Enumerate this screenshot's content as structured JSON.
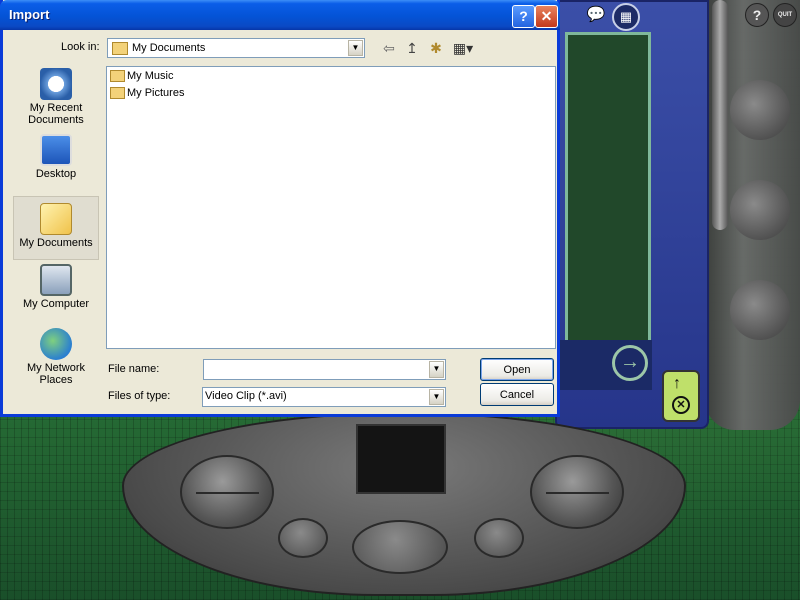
{
  "dialog": {
    "title": "Import",
    "help_btn": "?",
    "close_btn": "✕",
    "lookin_label": "Look in:",
    "lookin_value": "My Documents",
    "toolbar": {
      "back": "⇦",
      "up": "↥",
      "new_folder": "✱",
      "view": "▦▾"
    },
    "places": [
      {
        "label": "My Recent Documents",
        "icon": "recent-documents-icon"
      },
      {
        "label": "Desktop",
        "icon": "desktop-icon"
      },
      {
        "label": "My Documents",
        "icon": "my-documents-icon"
      },
      {
        "label": "My Computer",
        "icon": "my-computer-icon"
      },
      {
        "label": "My Network Places",
        "icon": "network-places-icon"
      }
    ],
    "files": [
      {
        "name": "My Music",
        "icon": "folder-icon"
      },
      {
        "name": "My Pictures",
        "icon": "folder-icon"
      }
    ],
    "filename_label": "File name:",
    "filename_value": "",
    "filetype_label": "Files of type:",
    "filetype_value": "Video Clip (*.avi)",
    "open_label": "Open",
    "cancel_label": "Cancel"
  },
  "background_app": {
    "help_icon": "?",
    "quit_icon": "QUIT",
    "next_arrow": "→",
    "upload": "↑",
    "eject": "✕"
  },
  "colors": {
    "titlebar": "#0453d6",
    "dialog_bg": "#ece9d8",
    "app_panel": "#26358a",
    "upload_btn": "#bfe06a"
  }
}
